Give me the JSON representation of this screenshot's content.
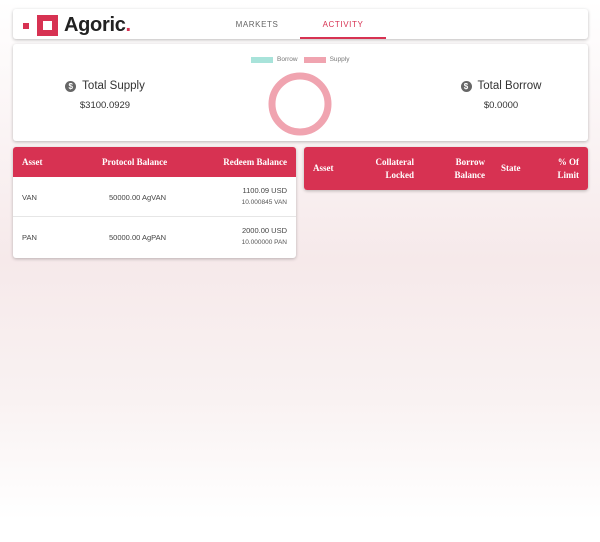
{
  "brand": {
    "name": "Agoric",
    "period": "."
  },
  "nav": {
    "tabs": [
      {
        "label": "MARKETS"
      },
      {
        "label": "ACTIVITY"
      }
    ]
  },
  "summary": {
    "total_supply_label": "Total Supply",
    "total_supply_value": "$3100.0929",
    "total_borrow_label": "Total Borrow",
    "total_borrow_value": "$0.0000"
  },
  "chart_data": {
    "type": "pie",
    "categories": [
      "Borrow",
      "Supply"
    ],
    "values": [
      0,
      3100.0929
    ],
    "colors": [
      "#a8e3da",
      "#f0a4b0"
    ],
    "legend_position": "top"
  },
  "supply_table": {
    "headers": [
      "Asset",
      "Protocol Balance",
      "Redeem Balance"
    ],
    "rows": [
      {
        "asset": "VAN",
        "protocol_balance": "50000.00 AgVAN",
        "redeem_usd": "1100.09 USD",
        "redeem_amount": "10.000845 VAN"
      },
      {
        "asset": "PAN",
        "protocol_balance": "50000.00 AgPAN",
        "redeem_usd": "2000.00 USD",
        "redeem_amount": "10.000000 PAN"
      }
    ]
  },
  "borrow_table": {
    "headers": {
      "asset": "Asset",
      "collateral_1": "Collateral",
      "collateral_2": "Locked",
      "borrow_1": "Borrow",
      "borrow_2": "Balance",
      "state": "State",
      "limit_1": "% Of",
      "limit_2": "Limit"
    }
  },
  "colors": {
    "accent": "#d73252",
    "borrow": "#a8e3da",
    "supply": "#f0a4b0"
  }
}
